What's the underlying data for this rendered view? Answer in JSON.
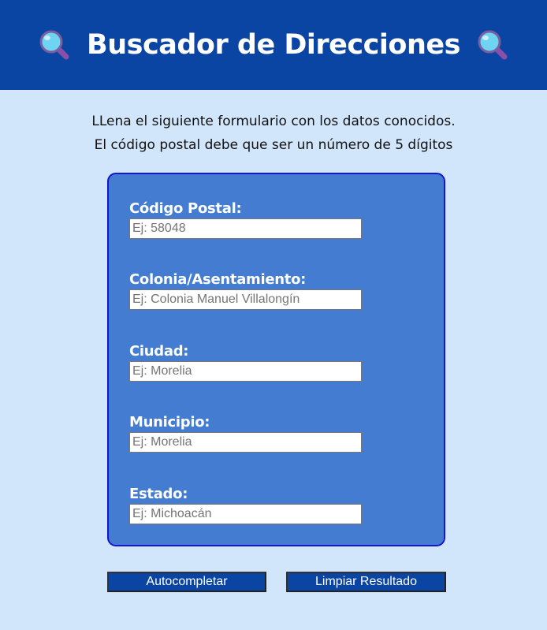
{
  "header": {
    "title": "Buscador de Direcciones",
    "icon_left": "magnifying-glass-icon",
    "icon_right": "magnifying-glass-icon"
  },
  "intro": {
    "line1": "LLena el siguiente formulario con los datos conocidos.",
    "line2": "El código postal debe que ser un número de 5 dígitos"
  },
  "form": {
    "fields": [
      {
        "label": "Código Postal:",
        "placeholder": "Ej: 58048",
        "value": ""
      },
      {
        "label": "Colonia/Asentamiento:",
        "placeholder": "Ej: Colonia Manuel Villalongín",
        "value": ""
      },
      {
        "label": "Ciudad:",
        "placeholder": "Ej: Morelia",
        "value": ""
      },
      {
        "label": "Municipio:",
        "placeholder": "Ej: Morelia",
        "value": ""
      },
      {
        "label": "Estado:",
        "placeholder": "Ej: Michoacán",
        "value": ""
      }
    ]
  },
  "buttons": {
    "autocomplete": "Autocompletar",
    "clear": "Limpiar Resultado"
  },
  "colors": {
    "header_bg": "#0b45a3",
    "page_bg": "#d1e5fb",
    "form_bg": "#437cd1",
    "form_border": "#1515d6",
    "button_bg": "#0b45a3"
  }
}
